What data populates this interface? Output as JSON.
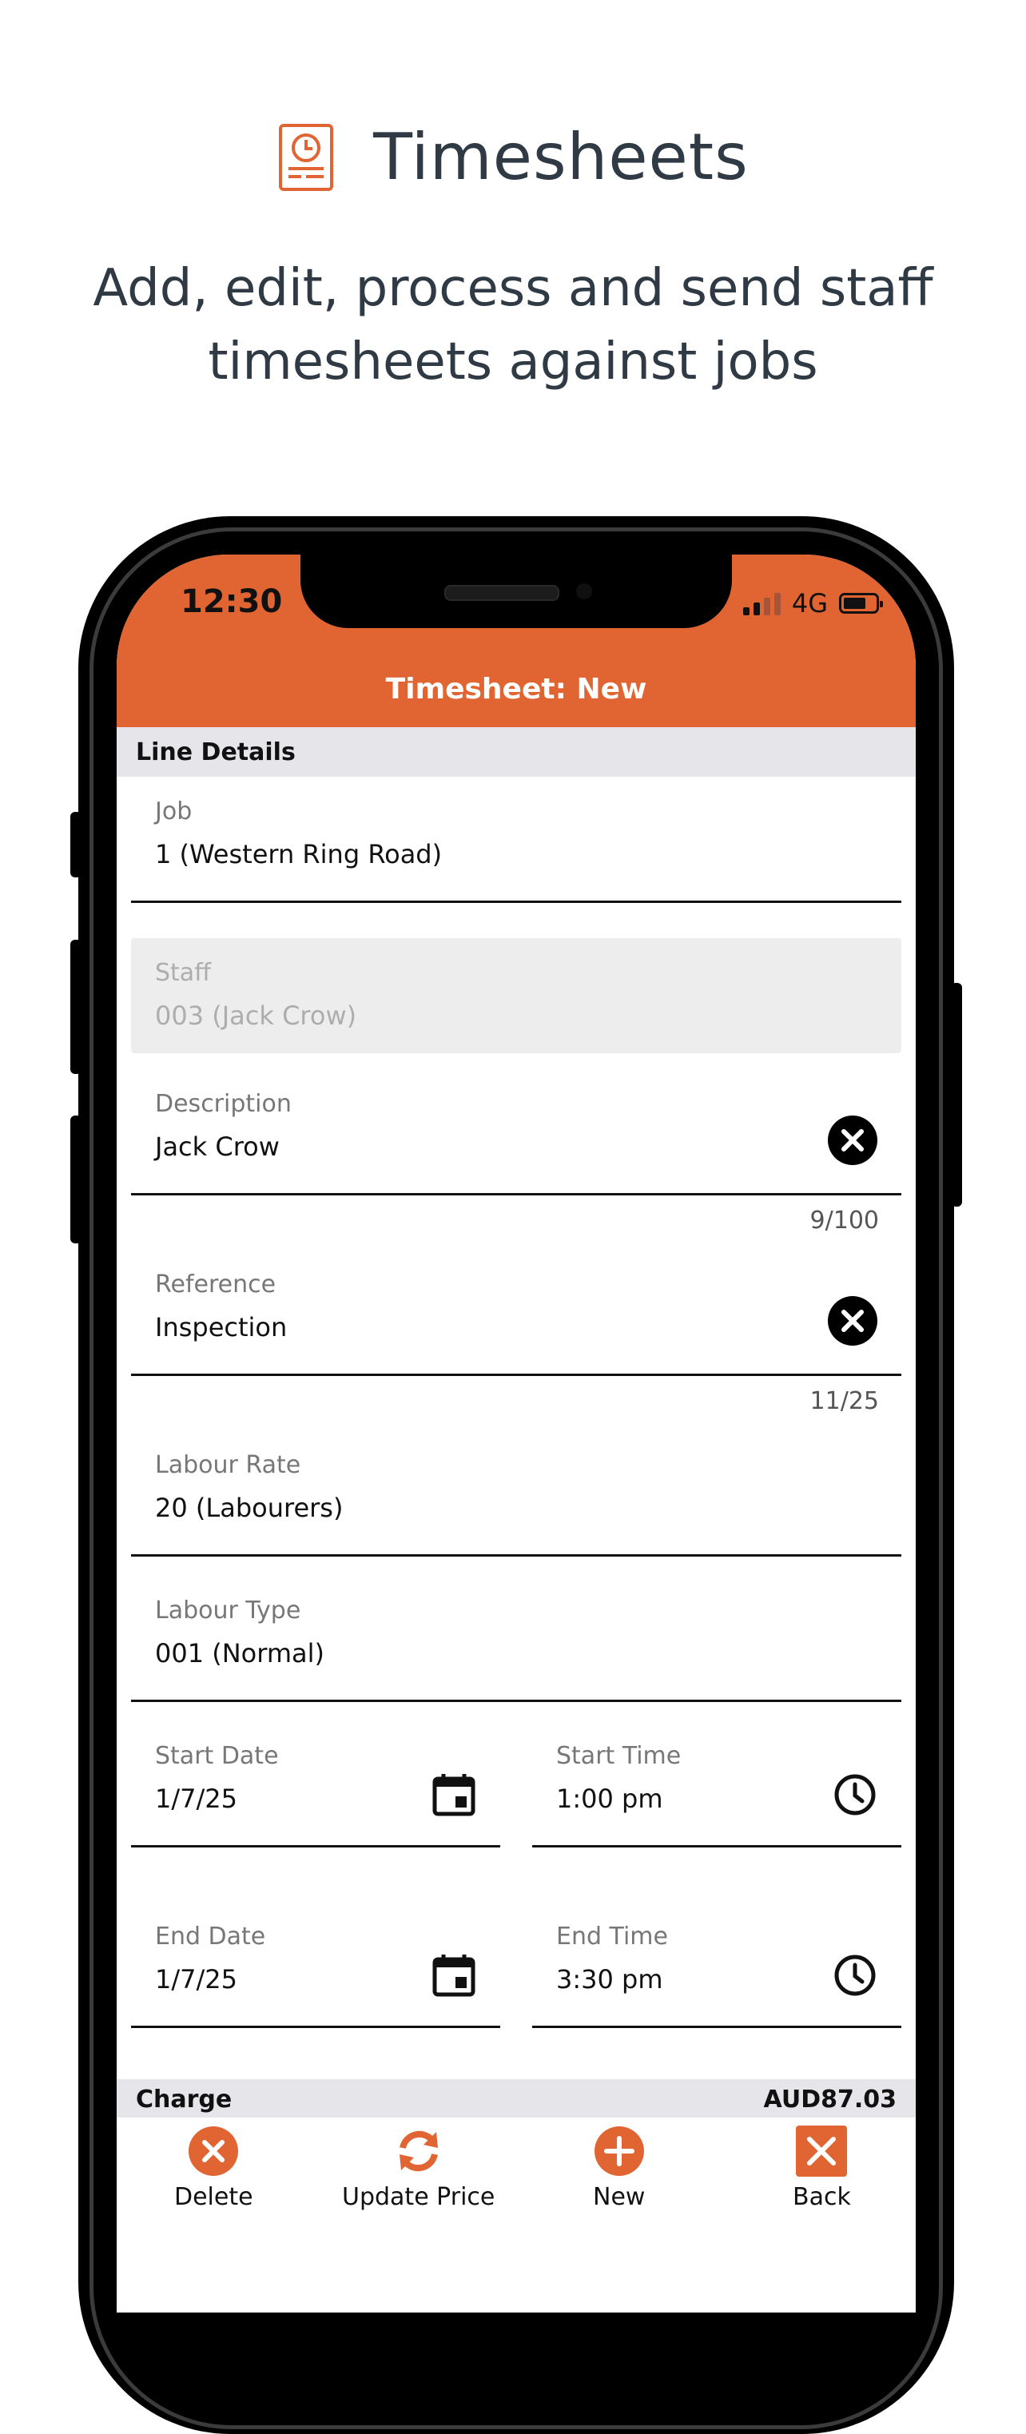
{
  "promo": {
    "title": "Timesheets",
    "subtitle": "Add, edit, process and send staff timesheets against jobs",
    "icon": "timesheet-clock-icon"
  },
  "status_bar": {
    "time": "12:30",
    "network": "4G"
  },
  "header": {
    "title": "Timesheet: New"
  },
  "sections": {
    "line_details": "Line Details",
    "charge_label": "Charge",
    "charge_value": "AUD87.03"
  },
  "fields": {
    "job": {
      "label": "Job",
      "value": "1 (Western Ring Road)"
    },
    "staff": {
      "label": "Staff",
      "value": "003 (Jack Crow)"
    },
    "description": {
      "label": "Description",
      "value": "Jack Crow",
      "counter": "9/100"
    },
    "reference": {
      "label": "Reference",
      "value": "Inspection",
      "counter": "11/25"
    },
    "labour_rate": {
      "label": "Labour Rate",
      "value": "20 (Labourers)"
    },
    "labour_type": {
      "label": "Labour Type",
      "value": "001 (Normal)"
    },
    "start_date": {
      "label": "Start Date",
      "value": "1/7/25"
    },
    "start_time": {
      "label": "Start Time",
      "value": "1:00 pm"
    },
    "end_date": {
      "label": "End Date",
      "value": "1/7/25"
    },
    "end_time": {
      "label": "End Time",
      "value": "3:30 pm"
    }
  },
  "bottom_bar": {
    "delete": "Delete",
    "update_price": "Update Price",
    "new": "New",
    "back": "Back"
  },
  "colors": {
    "accent": "#e06532",
    "section_bg": "#e5e5ea",
    "text_dark": "#2f3a44"
  }
}
